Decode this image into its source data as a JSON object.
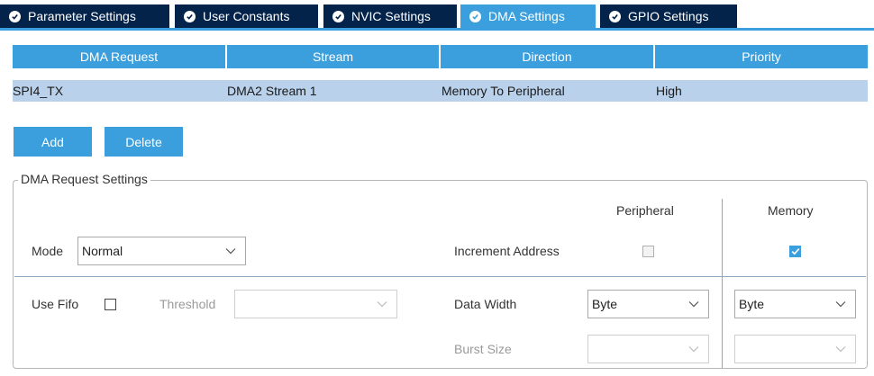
{
  "tabs": [
    {
      "label": "Parameter Settings",
      "active": false,
      "icon": "check-circle-icon"
    },
    {
      "label": "User Constants",
      "active": false,
      "icon": "check-circle-icon"
    },
    {
      "label": "NVIC Settings",
      "active": false,
      "icon": "check-circle-icon"
    },
    {
      "label": "DMA Settings",
      "active": true,
      "icon": "check-circle-icon"
    },
    {
      "label": "GPIO Settings",
      "active": false,
      "icon": "check-circle-icon"
    }
  ],
  "table": {
    "headers": [
      "DMA Request",
      "Stream",
      "Direction",
      "Priority"
    ],
    "rows": [
      [
        "SPI4_TX",
        "DMA2 Stream 1",
        "Memory To Peripheral",
        "High"
      ]
    ]
  },
  "buttons": {
    "add": "Add",
    "delete": "Delete"
  },
  "settings": {
    "title": "DMA Request Settings",
    "peripheral_header": "Peripheral",
    "memory_header": "Memory",
    "mode": {
      "label": "Mode",
      "value": "Normal"
    },
    "increment_address": {
      "label": "Increment Address",
      "peripheral_checked": false,
      "memory_checked": true
    },
    "use_fifo": {
      "label": "Use Fifo",
      "checked": false
    },
    "threshold": {
      "label": "Threshold",
      "value": ""
    },
    "data_width": {
      "label": "Data Width",
      "peripheral_value": "Byte",
      "memory_value": "Byte"
    },
    "burst_size": {
      "label": "Burst Size",
      "peripheral_value": "",
      "memory_value": ""
    }
  },
  "colors": {
    "accent": "#3a9fdc",
    "tab_dark": "#03234b",
    "row_selected": "#b9d1ea"
  }
}
